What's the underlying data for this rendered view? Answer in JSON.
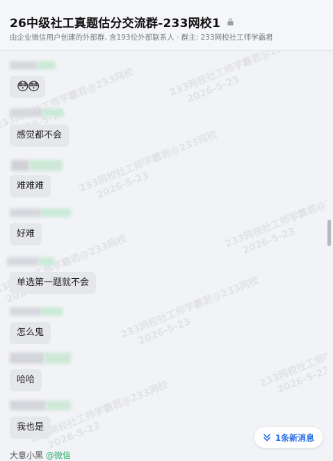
{
  "header": {
    "title": "26中级社工真题估分交流群-233网校1",
    "subtitle": "由企业微信用户创建的外部群, 含193位外部联系人 · 群主: 233网校社工师学霸君"
  },
  "messages": [
    {
      "text": "😳😳"
    },
    {
      "text": "感觉都不会"
    },
    {
      "text": "难难难"
    },
    {
      "text": "好难"
    },
    {
      "text": "单选第一题就不会"
    },
    {
      "text": "怎么鬼"
    },
    {
      "text": "哈哈"
    },
    {
      "text": "我也是"
    }
  ],
  "watermark": {
    "text": "233网校社工师学霸君@233网校",
    "date": "2026-5-23"
  },
  "new_message_button": {
    "label": "1条新消息",
    "icon": "double-chevron-down-icon"
  },
  "last_sender": {
    "name": "大意小黑",
    "tag": "@微信"
  },
  "colors": {
    "accent": "#2a6fe6",
    "wechat_green": "#2aae67",
    "bubble": "#e6e7eb"
  }
}
